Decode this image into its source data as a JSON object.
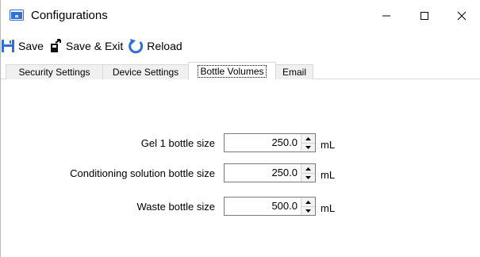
{
  "window": {
    "title": "Configurations"
  },
  "toolbar": {
    "save_label": "Save",
    "save_exit_label": "Save & Exit",
    "reload_label": "Reload"
  },
  "tabs": [
    {
      "label": "Security Settings"
    },
    {
      "label": "Device Settings"
    },
    {
      "label": "Bottle Volumes",
      "selected": true
    },
    {
      "label": "Email"
    }
  ],
  "bottle_volumes": {
    "fields": [
      {
        "label": "Gel 1 bottle size",
        "value": "250.0",
        "unit": "mL"
      },
      {
        "label": "Conditioning solution bottle size",
        "value": "250.0",
        "unit": "mL"
      },
      {
        "label": "Waste bottle size",
        "value": "500.0",
        "unit": "mL"
      }
    ]
  },
  "colors": {
    "accent": "#2f6fd6",
    "tab_inactive": "#f0f0f0",
    "border": "#d9d9d9"
  },
  "icons": [
    "app-icon",
    "save-icon",
    "save-exit-icon",
    "reload-icon",
    "minimize-icon",
    "maximize-icon",
    "close-icon"
  ]
}
